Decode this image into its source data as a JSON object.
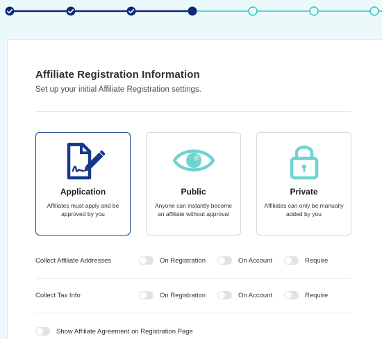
{
  "stepper": {
    "steps": [
      {
        "state": "completed",
        "icon": "check-icon"
      },
      {
        "state": "completed",
        "icon": "check-icon"
      },
      {
        "state": "completed",
        "icon": "check-icon"
      },
      {
        "state": "current"
      },
      {
        "state": "upcoming"
      },
      {
        "state": "upcoming"
      },
      {
        "state": "upcoming"
      }
    ],
    "colors": {
      "completed": "#0b2a78",
      "upcoming": "#2ec4c4"
    }
  },
  "header": {
    "title": "Affiliate Registration Information",
    "subtitle": "Set up your initial Affiliate Registration settings."
  },
  "options": [
    {
      "title": "Application",
      "description": "Affiliates must apply and be approved by you",
      "icon": "application-form-icon",
      "selected": true
    },
    {
      "title": "Public",
      "description": "Anyone can instantly become an affiliate without approval",
      "icon": "eye-icon",
      "selected": false
    },
    {
      "title": "Private",
      "description": "Affiliates can only be manually added by you",
      "icon": "lock-icon",
      "selected": false
    }
  ],
  "settings": {
    "addresses": {
      "label": "Collect Affiliate Addresses",
      "toggles": [
        "On Registration",
        "On Account",
        "Require"
      ]
    },
    "tax": {
      "label": "Collect Tax Info",
      "toggles": [
        "On Registration",
        "On Account",
        "Require"
      ]
    },
    "agreement": {
      "label": "Show Affiliate Agreement on Registration Page"
    }
  },
  "colors": {
    "accent_dark": "#1b3f8f",
    "icon_application": "#15388a",
    "icon_public_private": "#6fd3d0",
    "background": "#ecf9fa"
  }
}
